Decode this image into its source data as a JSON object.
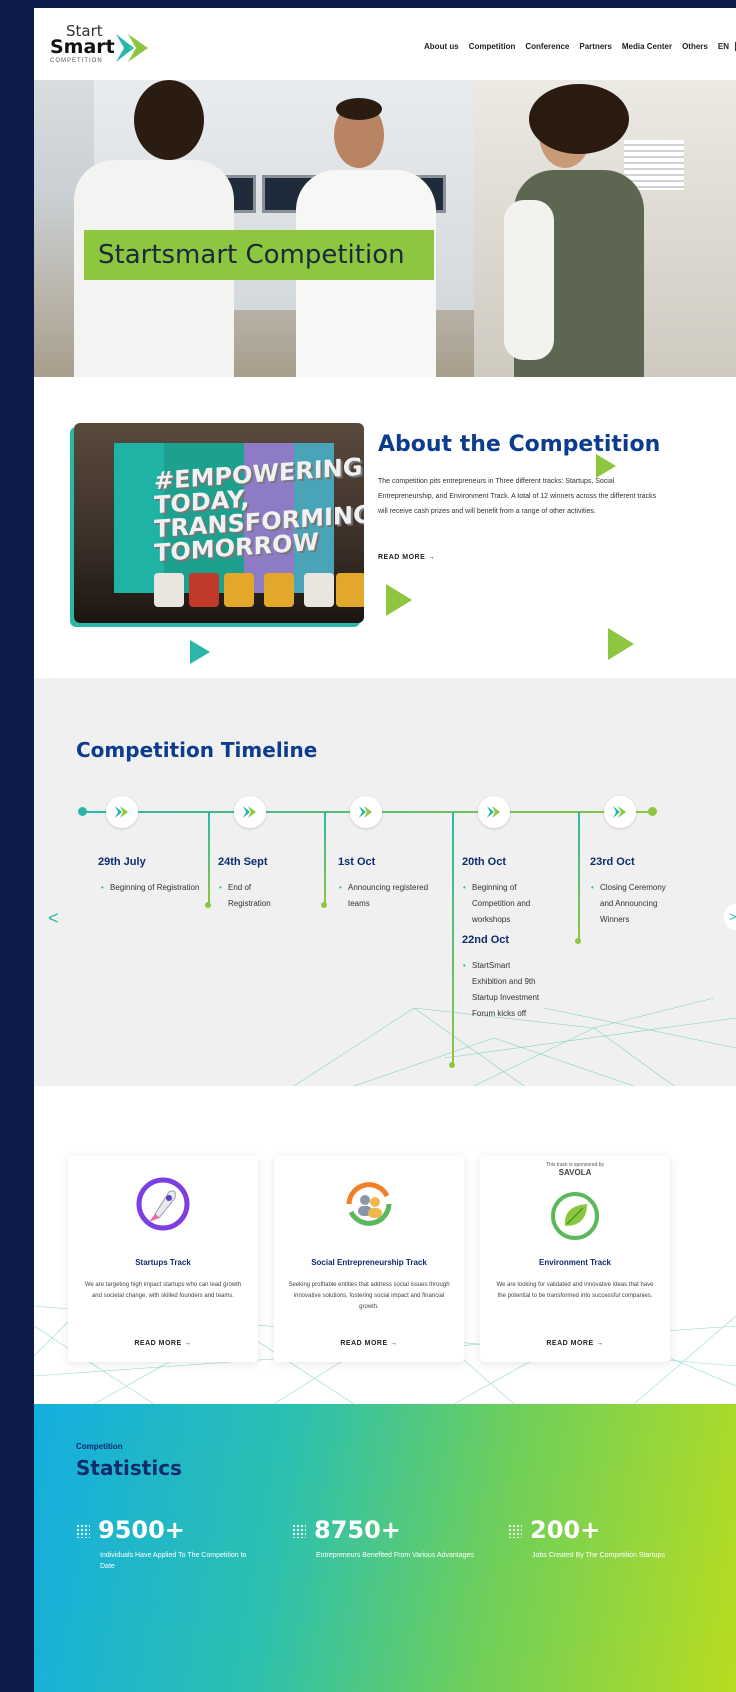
{
  "header": {
    "logo": {
      "line1": "Start",
      "line2": "Smart",
      "line3": "COMPETITION"
    },
    "nav": [
      "About us",
      "Competition",
      "Conference",
      "Partners",
      "Media Center",
      "Others",
      "EN"
    ]
  },
  "hero": {
    "title": "Startsmart Competition"
  },
  "about": {
    "title": "About the Competition",
    "text": "The competition pits entrepreneurs in Three different tracks: Startups, Social Entrepreneurship, and Environment Track. A total of 12 winners across the different tracks will receive cash prizes and will benefit from a range of other activities.",
    "read_more": "READ MORE →",
    "image_text": "#EMPOWERING TODAY, TRANSFORMING TOMORROW"
  },
  "timeline": {
    "title": "Competition Timeline",
    "items": [
      {
        "date": "29th July",
        "desc": "Beginning of Registration"
      },
      {
        "date": "24th Sept",
        "desc": "End of Registration"
      },
      {
        "date": "1st Oct",
        "desc": "Announcing registered teams"
      },
      {
        "date": "20th Oct",
        "desc": "Beginning of Competition and workshops",
        "date2": "22nd Oct",
        "desc2": "StartSmart Exhibition and 9th Startup Investment Forum kicks off"
      },
      {
        "date": "23rd Oct",
        "desc": "Closing Ceremony and Announcing Winners"
      }
    ],
    "prev": "<",
    "next": ">"
  },
  "tracks": [
    {
      "title": "Startups Track",
      "desc": "We are targeting high impact startups who can lead growth and societal change, with skilled founders and teams.",
      "read_more": "READ MORE →",
      "icon": "rocket-icon"
    },
    {
      "title": "Social Entrepreneurship Track",
      "desc": "Seeking profitable entities that address social issues through innovative solutions, fostering social impact and financial growth.",
      "read_more": "READ MORE →",
      "icon": "community-icon"
    },
    {
      "title": "Environment Track",
      "desc": "We are looking for validated and innovative ideas that have the potential to be transformed into successful companies.",
      "read_more": "READ MORE →",
      "icon": "recycle-leaf-icon",
      "sponsor_caption": "This track is sponsored by",
      "sponsor": "SAVOLA"
    }
  ],
  "stats": {
    "subtitle": "Competition",
    "title": "Statistics",
    "items": [
      {
        "value": "9500+",
        "label": "Individuals Have Applied To The Competition to Date"
      },
      {
        "value": "8750+",
        "label": "Entrepreneurs Benefited From Various Advantages"
      },
      {
        "value": "200+",
        "label": "Jobs Created By The Competition Startups"
      }
    ]
  },
  "colors": {
    "brand_green": "#8dc63f",
    "brand_teal": "#2bb7a8",
    "navy": "#0c3c8c",
    "background": "#0d1b4a"
  }
}
